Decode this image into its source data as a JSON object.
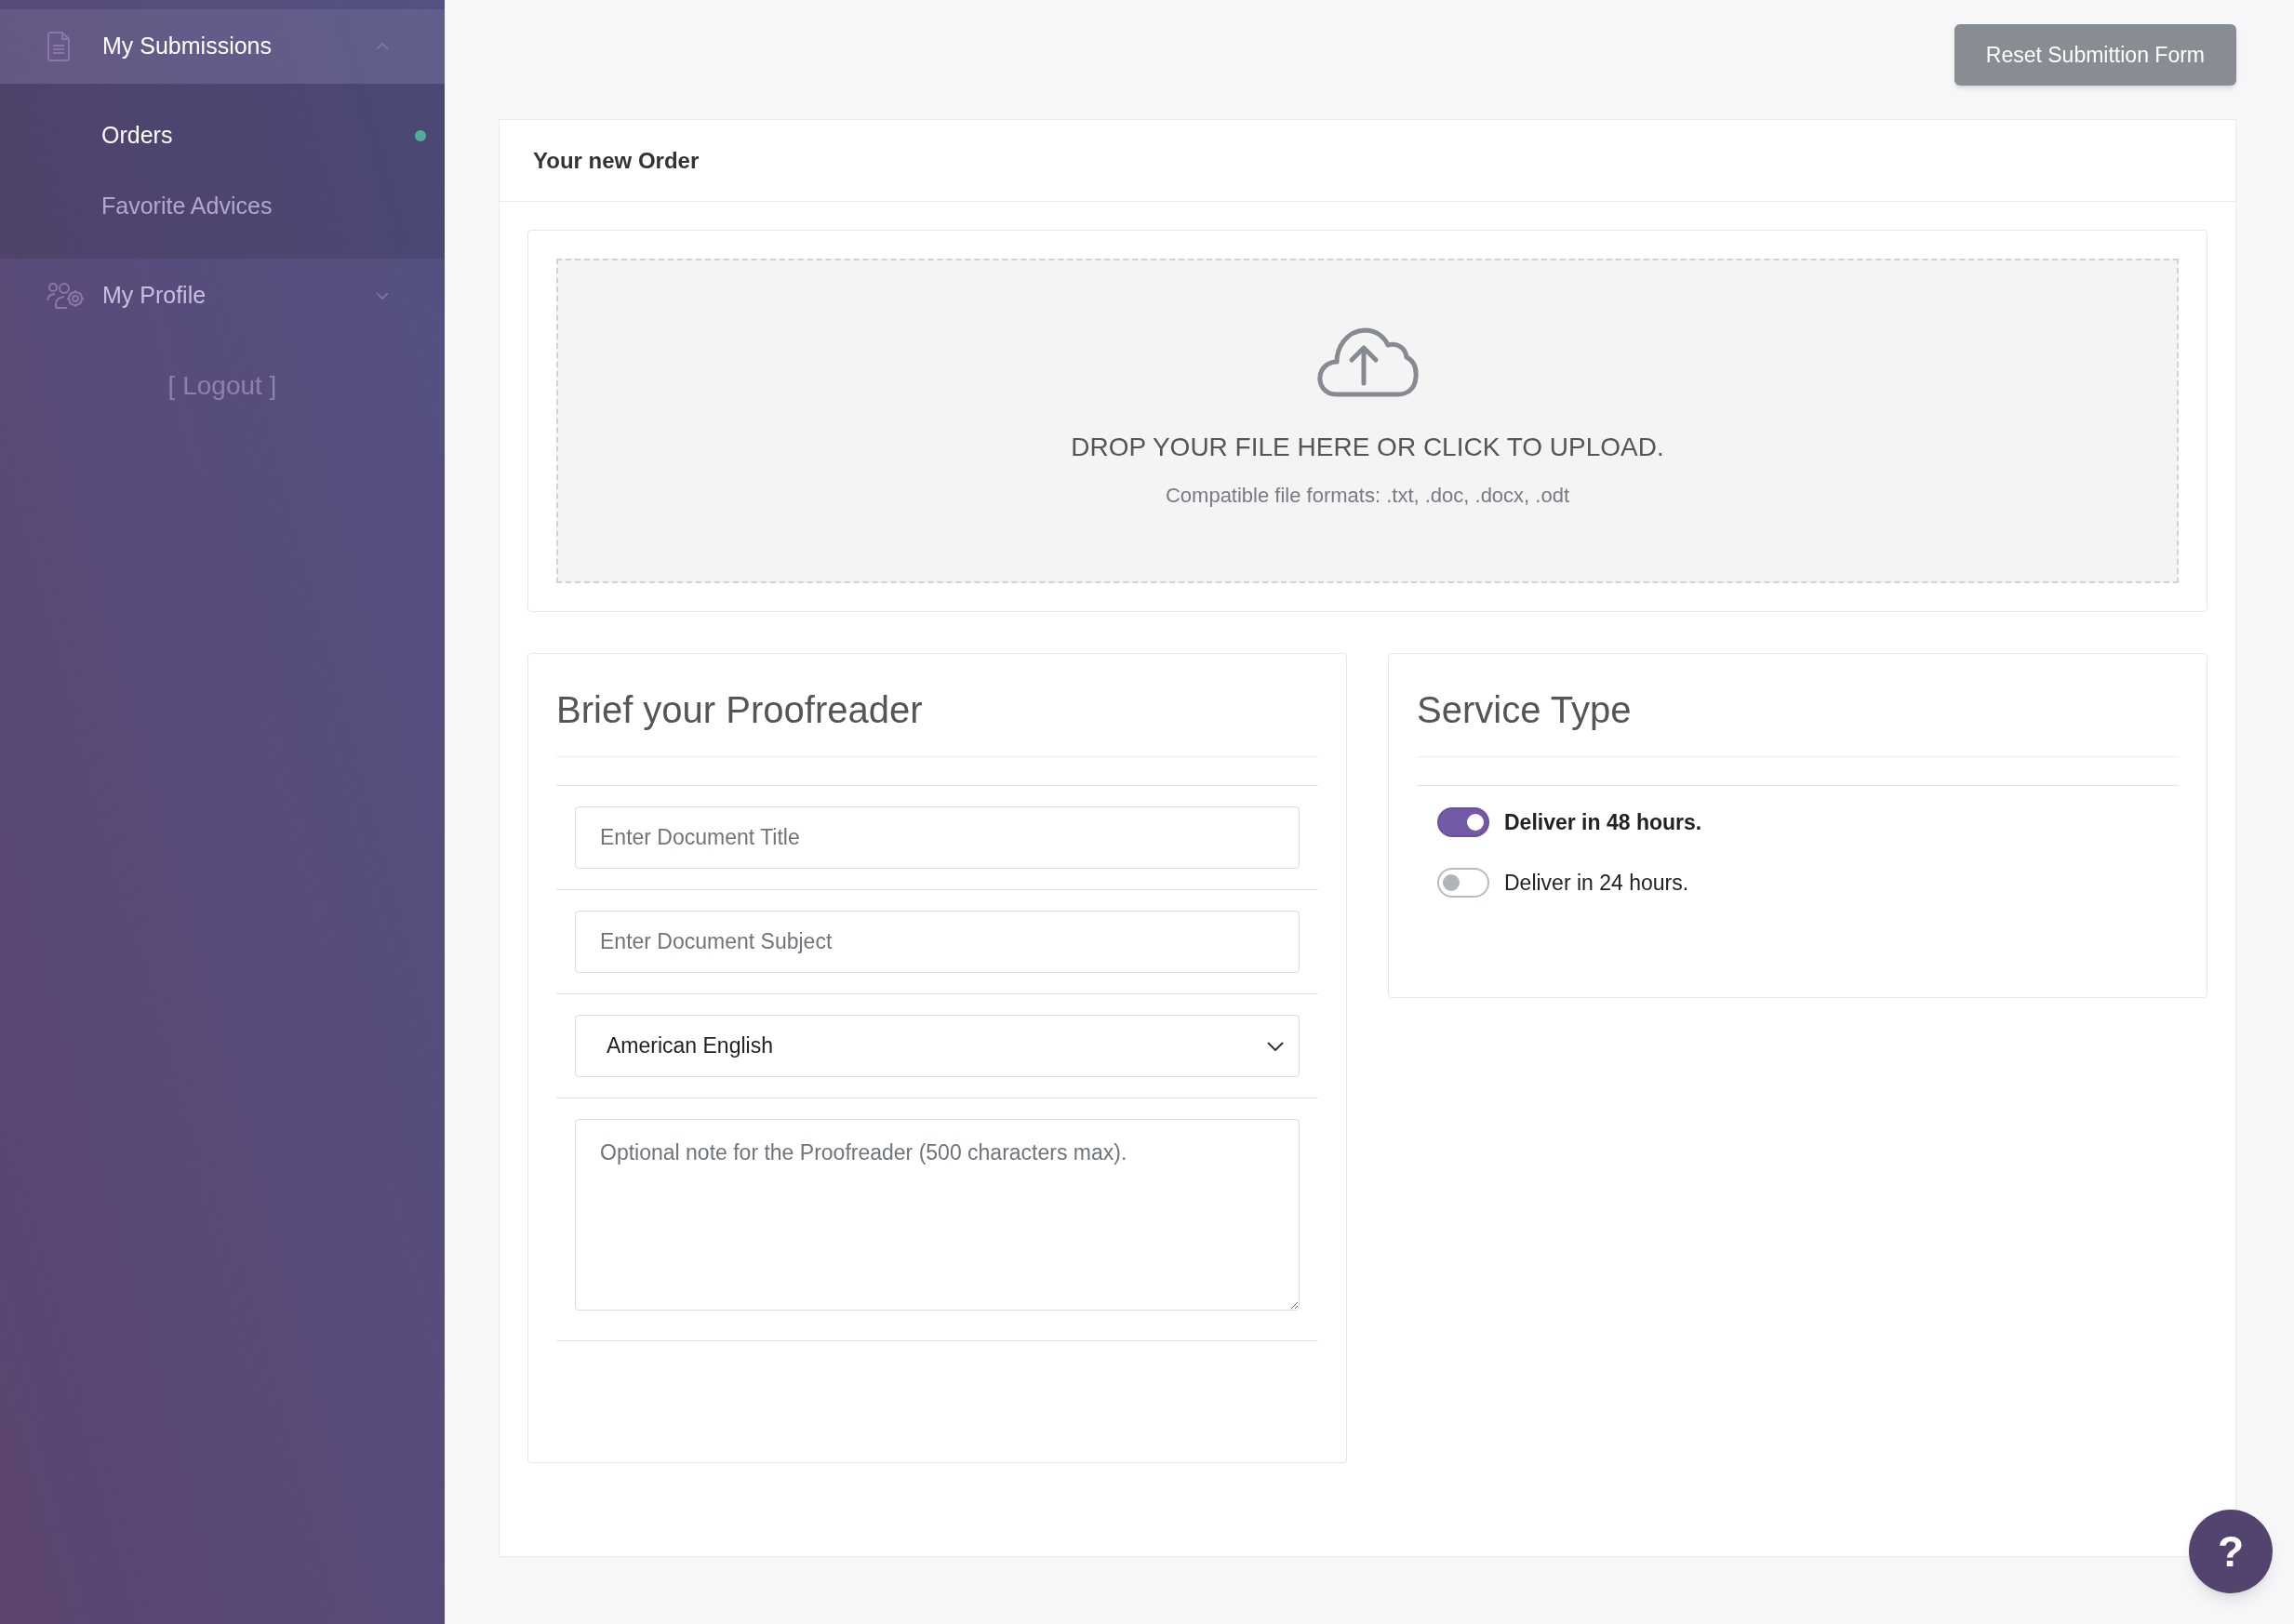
{
  "sidebar": {
    "groups": [
      {
        "label": "My Submissions",
        "kind": "submissions",
        "expanded": true,
        "children": [
          {
            "label": "Orders",
            "selected": true
          },
          {
            "label": "Favorite Advices",
            "selected": false
          }
        ]
      },
      {
        "label": "My Profile",
        "kind": "profile",
        "expanded": false
      }
    ],
    "logout": "[ Logout ]"
  },
  "reset_button": "Reset Submittion Form",
  "order_card": {
    "title": "Your new Order",
    "upload": {
      "heading": "DROP YOUR FILE HERE OR CLICK TO UPLOAD.",
      "formats": "Compatible file formats: .txt, .doc, .docx, .odt"
    },
    "brief": {
      "title": "Brief your Proofreader",
      "fields": [
        {
          "kind": "input",
          "placeholder": "Enter Document Title"
        },
        {
          "kind": "input",
          "placeholder": "Enter Document Subject"
        },
        {
          "kind": "select",
          "value": "American English"
        },
        {
          "kind": "textarea",
          "placeholder": "Optional note for the Proofreader (500 characters max)."
        }
      ]
    },
    "service": {
      "title": "Service Type",
      "options": [
        {
          "label": "Deliver in 48 hours.",
          "on": true
        },
        {
          "label": "Deliver in 24 hours.",
          "on": false
        }
      ]
    }
  },
  "help_button": "?"
}
